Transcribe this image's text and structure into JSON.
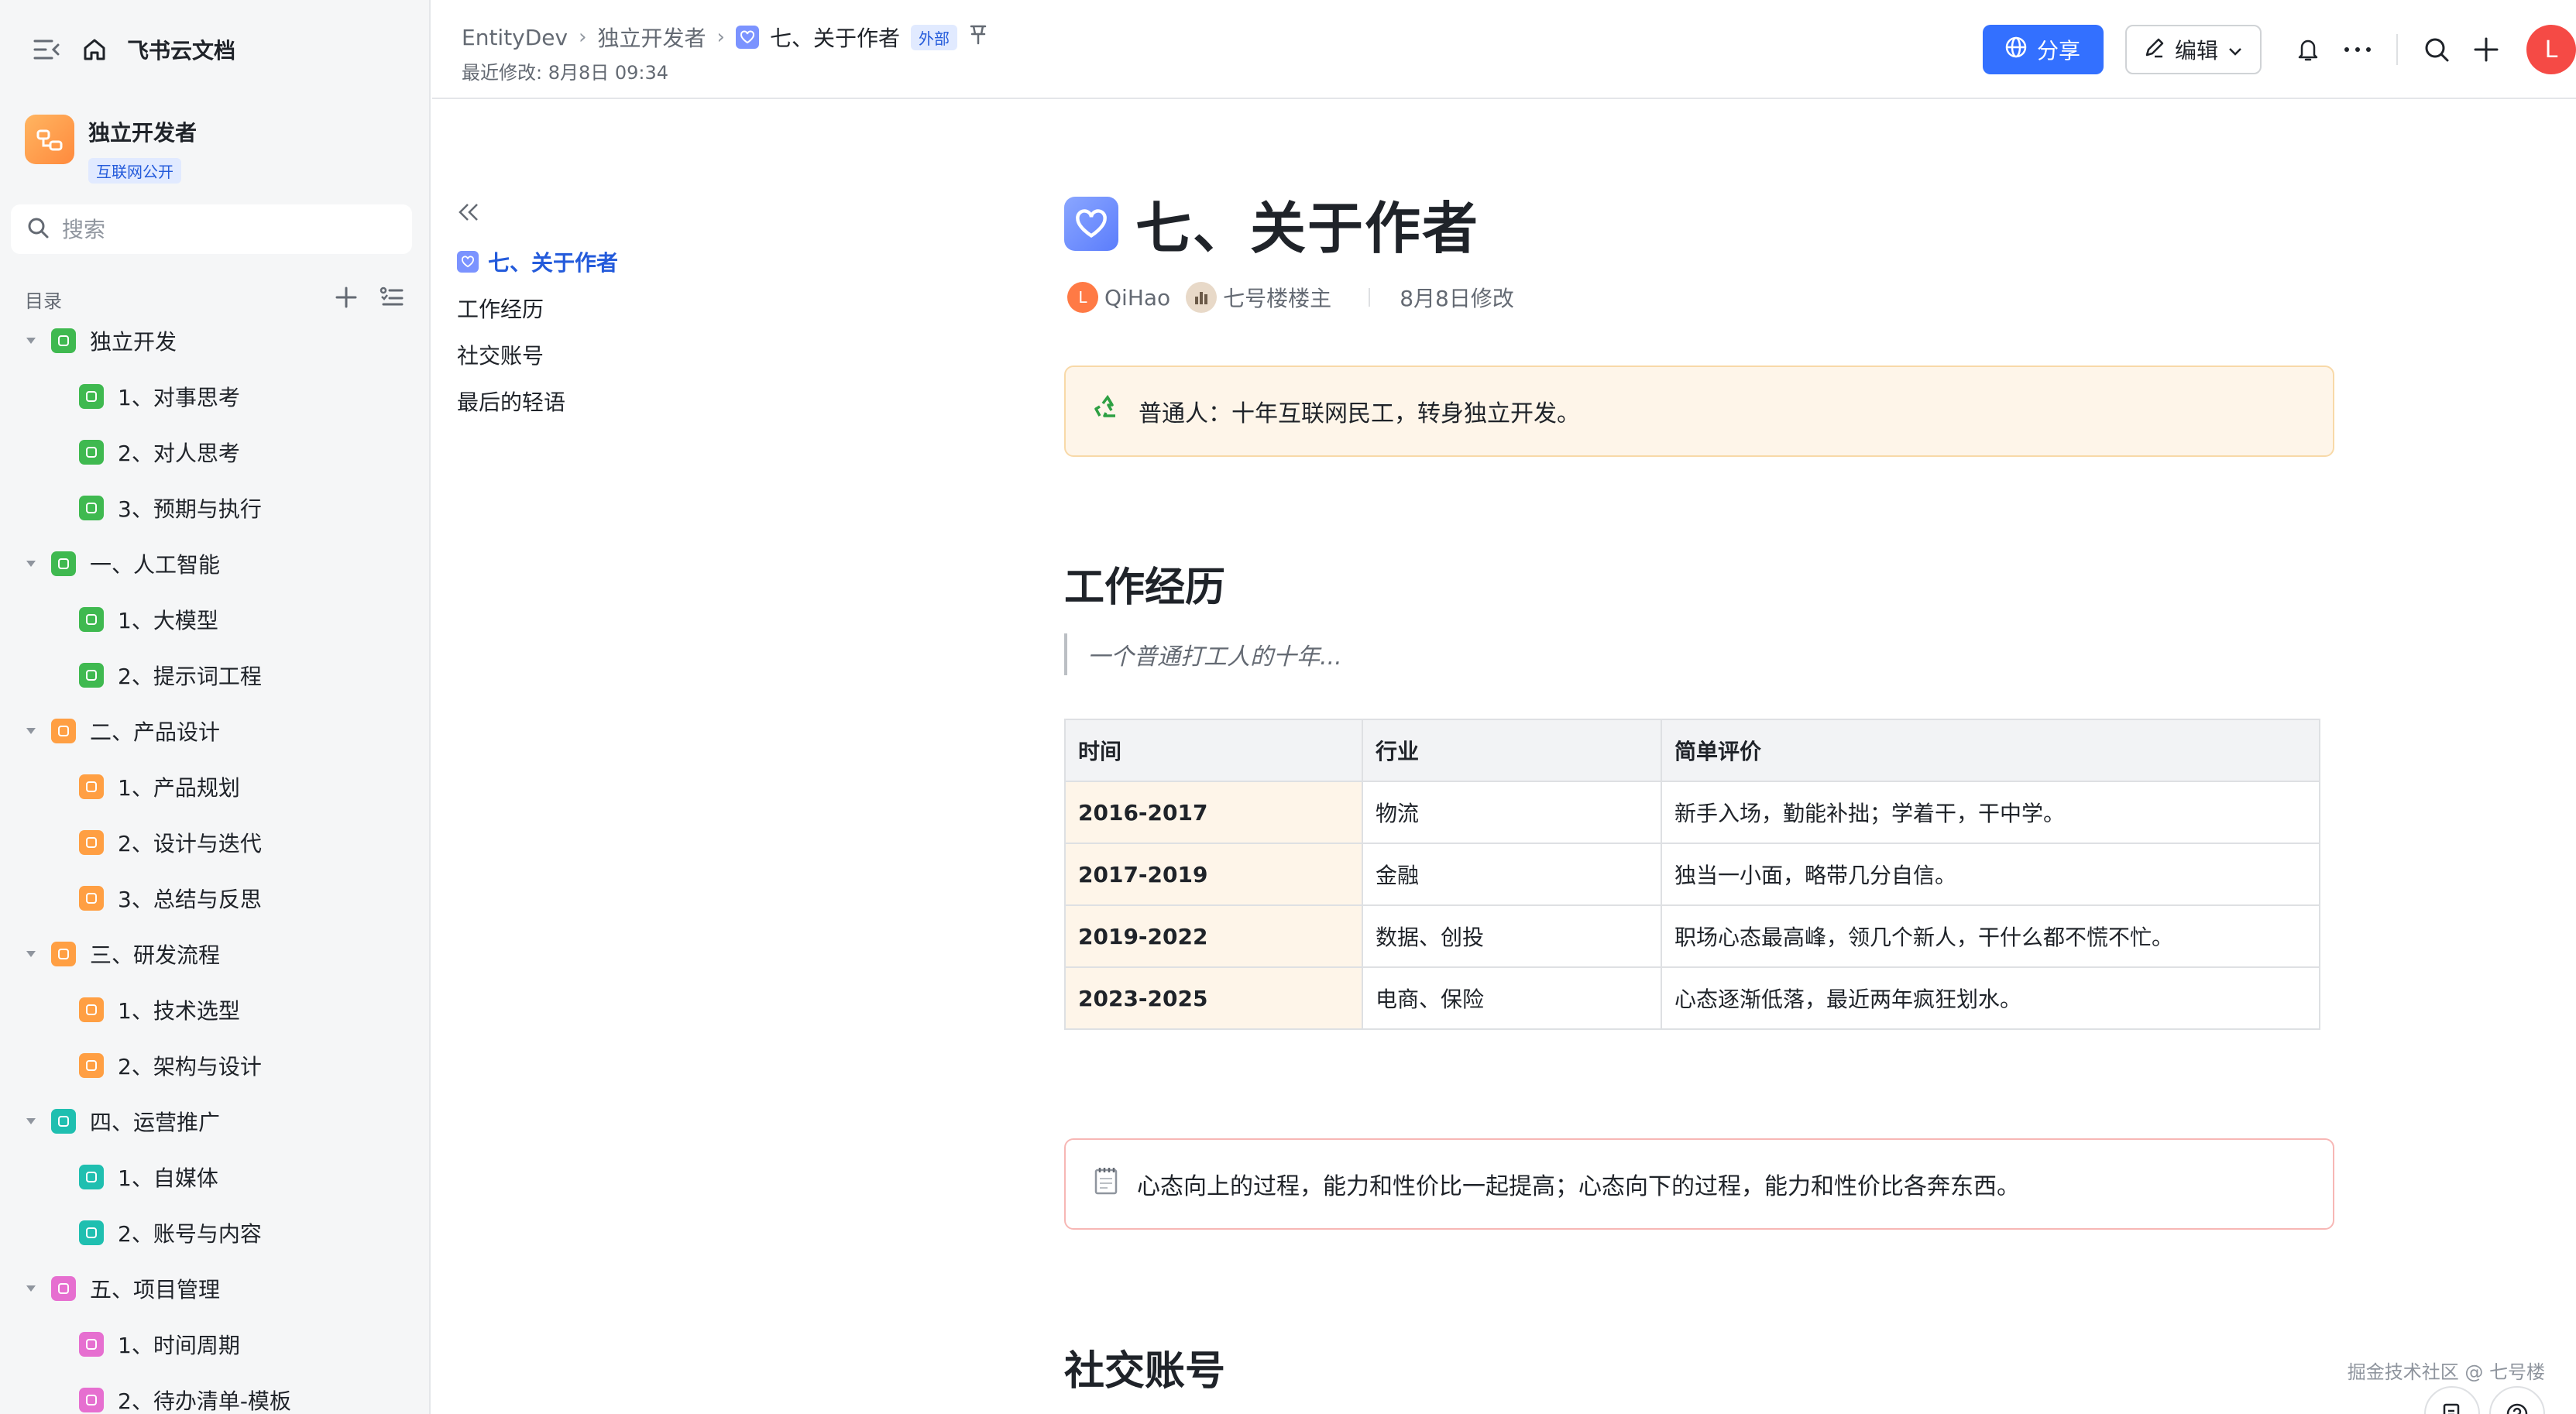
{
  "sidebar": {
    "app_title": "飞书云文档",
    "space": {
      "name": "独立开发者",
      "badge": "互联网公开"
    },
    "search_placeholder": "搜索",
    "toc_label": "目录",
    "items": [
      {
        "label": "独立开发",
        "level": 0,
        "color": "#3fb950"
      },
      {
        "label": "1、对事思考",
        "level": 1,
        "color": "#3fb950"
      },
      {
        "label": "2、对人思考",
        "level": 1,
        "color": "#3fb950"
      },
      {
        "label": "3、预期与执行",
        "level": 1,
        "color": "#3fb950"
      },
      {
        "label": "一、人工智能",
        "level": 0,
        "color": "#3fb950"
      },
      {
        "label": "1、大模型",
        "level": 1,
        "color": "#3fb950"
      },
      {
        "label": "2、提示词工程",
        "level": 1,
        "color": "#3fb950"
      },
      {
        "label": "二、产品设计",
        "level": 0,
        "color": "#ff9f43"
      },
      {
        "label": "1、产品规划",
        "level": 1,
        "color": "#ff9f43"
      },
      {
        "label": "2、设计与迭代",
        "level": 1,
        "color": "#ff9f43"
      },
      {
        "label": "3、总结与反思",
        "level": 1,
        "color": "#ff9f43"
      },
      {
        "label": "三、研发流程",
        "level": 0,
        "color": "#ff9f43"
      },
      {
        "label": "1、技术选型",
        "level": 1,
        "color": "#ff9f43"
      },
      {
        "label": "2、架构与设计",
        "level": 1,
        "color": "#ff9f43"
      },
      {
        "label": "四、运营推广",
        "level": 0,
        "color": "#1fbfb0"
      },
      {
        "label": "1、自媒体",
        "level": 1,
        "color": "#1fbfb0"
      },
      {
        "label": "2、账号与内容",
        "level": 1,
        "color": "#1fbfb0"
      },
      {
        "label": "五、项目管理",
        "level": 0,
        "color": "#e66fd0"
      },
      {
        "label": "1、时间周期",
        "level": 1,
        "color": "#e66fd0"
      },
      {
        "label": "2、待办清单-模板",
        "level": 1,
        "color": "#e66fd0"
      }
    ]
  },
  "header": {
    "breadcrumbs": [
      "EntityDev",
      "独立开发者",
      "七、关于作者"
    ],
    "external_badge": "外部",
    "last_modified": "最近修改: 8月8日 09:34",
    "share_label": "分享",
    "edit_label": "编辑",
    "avatar_letter": "L"
  },
  "outline": {
    "items": [
      "七、关于作者",
      "工作经历",
      "社交账号",
      "最后的轻语"
    ]
  },
  "doc": {
    "title": "七、关于作者",
    "author": "QiHao",
    "author_avatar": "L",
    "owner": "七号楼楼主",
    "modified": "8月8日修改",
    "callout1": "普通人：十年互联网民工，转身独立开发。",
    "section1": "工作经历",
    "quote": "一个普通打工人的十年...",
    "table": {
      "headers": [
        "时间",
        "行业",
        "简单评价"
      ],
      "rows": [
        [
          "2016-2017",
          "物流",
          "新手入场，勤能补拙；学着干，干中学。"
        ],
        [
          "2017-2019",
          "金融",
          "独当一小面，略带几分自信。"
        ],
        [
          "2019-2022",
          "数据、创投",
          "职场心态最高峰，领几个新人，干什么都不慌不忙。"
        ],
        [
          "2023-2025",
          "电商、保险",
          "心态逐渐低落，最近两年疯狂划水。"
        ]
      ]
    },
    "callout2": "心态向上的过程，能力和性价比一起提高；心态向下的过程，能力和性价比各奔东西。",
    "section2": "社交账号"
  },
  "watermark": "掘金技术社区 @ 七号楼",
  "colors": {
    "accent": "#3370ff",
    "link": "#245bdb",
    "callout_bg": "#fef5e9"
  }
}
